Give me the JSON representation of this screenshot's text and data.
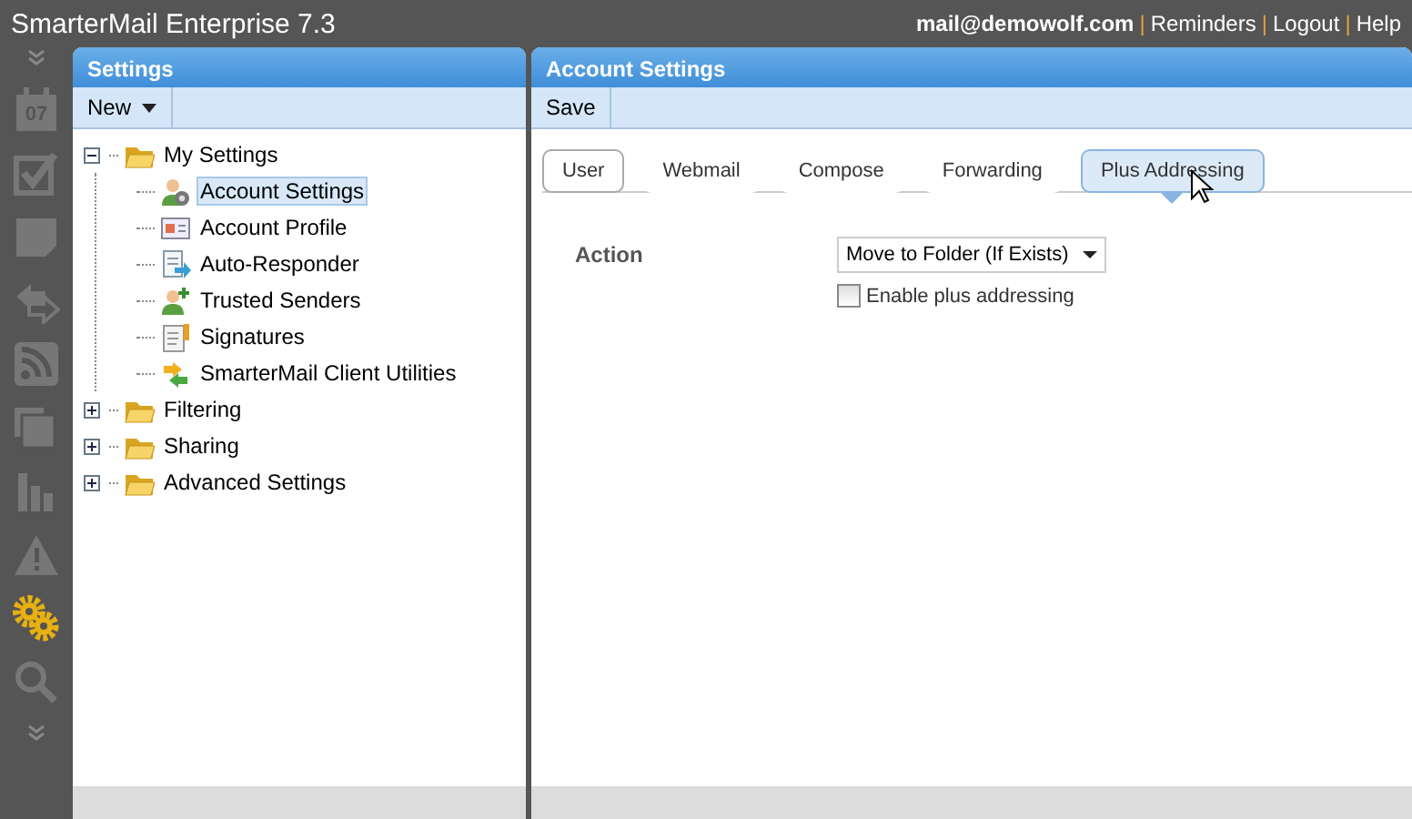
{
  "window": {
    "title": "SmarterMail Enterprise 7.3"
  },
  "top_separator": "|",
  "top_links": [
    {
      "text": "mail@demowolf.com",
      "kind": "user"
    },
    {
      "text": "Reminders",
      "kind": "link"
    },
    {
      "text": "Logout",
      "kind": "link"
    },
    {
      "text": "Help",
      "kind": "link"
    }
  ],
  "rail": {
    "calendar_day": "07",
    "items": [
      {
        "kind": "calendar",
        "selected": false
      },
      {
        "kind": "tasks",
        "selected": false
      },
      {
        "kind": "notes",
        "selected": false
      },
      {
        "kind": "sync",
        "selected": false
      },
      {
        "kind": "rss",
        "selected": false
      },
      {
        "kind": "files",
        "selected": false
      },
      {
        "kind": "reports",
        "selected": false
      },
      {
        "kind": "alerts",
        "selected": false
      },
      {
        "kind": "settings",
        "selected": true
      },
      {
        "kind": "search",
        "selected": false
      }
    ]
  },
  "settings_panel": {
    "title": "Settings",
    "new_button": "New",
    "tree": [
      {
        "label": "My Settings",
        "kind": "folder",
        "expanded": true,
        "children": [
          {
            "label": "Account Settings",
            "kind": "account",
            "selected": true
          },
          {
            "label": "Account Profile",
            "kind": "profile",
            "selected": false
          },
          {
            "label": "Auto-Responder",
            "kind": "responder",
            "selected": false
          },
          {
            "label": "Trusted Senders",
            "kind": "trusted",
            "selected": false
          },
          {
            "label": "Signatures",
            "kind": "signature",
            "selected": false
          },
          {
            "label": "SmarterMail Client Utilities",
            "kind": "utilities",
            "selected": false
          }
        ]
      },
      {
        "label": "Filtering",
        "kind": "folder",
        "expanded": false
      },
      {
        "label": "Sharing",
        "kind": "folder",
        "expanded": false
      },
      {
        "label": "Advanced Settings",
        "kind": "folder",
        "expanded": false
      }
    ]
  },
  "account_panel": {
    "title": "Account Settings",
    "save_button": "Save",
    "tabs": [
      {
        "label": "User",
        "selected": false,
        "focused": true
      },
      {
        "label": "Webmail",
        "selected": false,
        "focused": false
      },
      {
        "label": "Compose",
        "selected": false,
        "focused": false
      },
      {
        "label": "Forwarding",
        "selected": false,
        "focused": false
      },
      {
        "label": "Plus Addressing",
        "selected": true,
        "focused": false
      }
    ],
    "action_label": "Action",
    "action_value": "Move to Folder (If Exists)",
    "enable_checkbox": {
      "label": "Enable plus addressing",
      "checked": false
    }
  }
}
